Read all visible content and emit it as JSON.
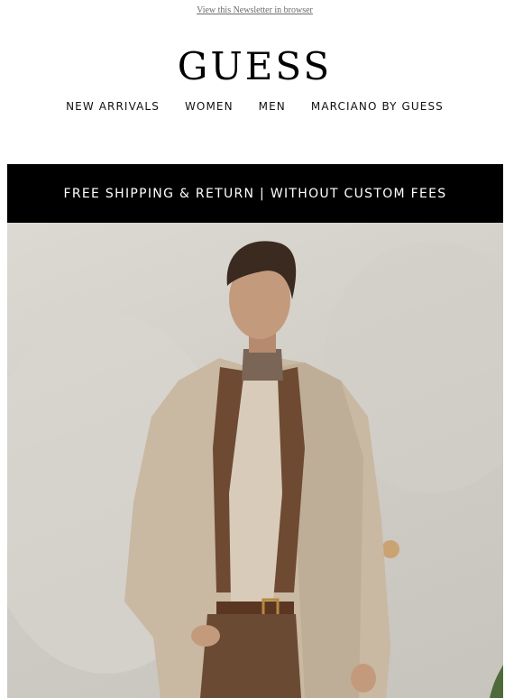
{
  "header": {
    "browser_link": "View this Newsletter in browser",
    "logo": "GUESS"
  },
  "nav": {
    "items": [
      {
        "label": "NEW ARRIVALS"
      },
      {
        "label": "WOMEN"
      },
      {
        "label": "MEN"
      },
      {
        "label": "MARCIANO BY GUESS"
      }
    ]
  },
  "banner": {
    "text": "FREE SHIPPING & RETURN | WITHOUT CUSTOM FEES"
  },
  "hero": {
    "image_icon": "hero-photo-icon"
  },
  "colors": {
    "banner_background": "#000000",
    "banner_text": "#ffffff",
    "link_text": "#6b6b6b",
    "hero_background": "#d4d0ca",
    "coat": "#c9b8a2",
    "jacket": "#6e4a32",
    "turtleneck": "#7a6556"
  }
}
